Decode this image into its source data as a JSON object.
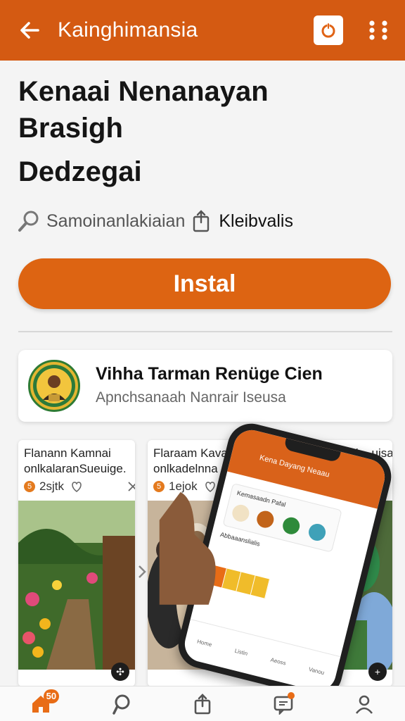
{
  "topbar": {
    "title": "Kainghimansia",
    "back_icon": "arrow-left-icon",
    "action_icon": "power-icon",
    "menu_icon": "kebab-menu-icon",
    "bg_color": "#d45a12"
  },
  "app": {
    "title_line1": "Kenaai Nenanayan",
    "title_line2": "Brasigh",
    "title_line3": "Dedzegai",
    "meta_left": "Samoinanlakiaian",
    "meta_right": "Kleibvalis"
  },
  "install": {
    "label": "Instal",
    "color": "#dd6412"
  },
  "developer": {
    "name": "Vihha Tarman Renüge Cien",
    "subtitle": "Apnchsanaah Nanrair Iseusa"
  },
  "cards": [
    {
      "title": "Flanann Kamnai onlkalaranSueuige.",
      "meta": "2sjtk",
      "badge": "5"
    },
    {
      "title": "Flaraam Kavanati onlkadelnna",
      "meta": "1ejok",
      "badge": "5"
    },
    {
      "title": "Kamnai ...uisa",
      "meta": "",
      "badge": ""
    }
  ],
  "phone": {
    "header_text": "Kena Dayang Neaau",
    "card_title": "Kemasaadn Pafal",
    "row_text": "Abbaaanslialis",
    "nav": [
      "Home",
      "Listin",
      "Aeoss",
      "Vanou"
    ]
  },
  "bottom_nav": {
    "items": [
      "home-icon",
      "explore-icon",
      "share-icon",
      "messages-icon",
      "profile-icon"
    ],
    "home_badge": "50"
  }
}
